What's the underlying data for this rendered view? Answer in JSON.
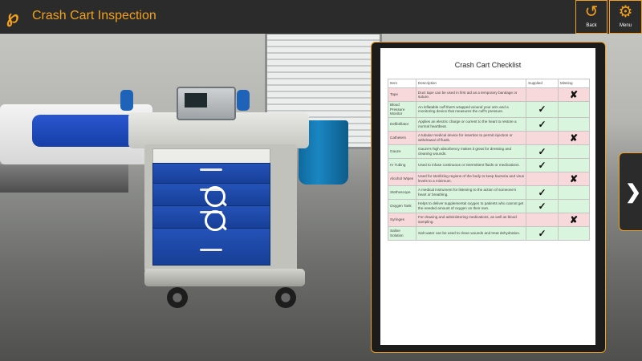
{
  "app": {
    "title": "Crash Cart Inspection",
    "logo_icon": "brand-logo-icon"
  },
  "header": {
    "back": {
      "label": "Back",
      "icon": "undo-arrow-icon"
    },
    "menu": {
      "label": "Menu",
      "icon": "gear-icon"
    }
  },
  "checklist": {
    "title": "Crash Cart Checklist",
    "columns": [
      "Item",
      "Description",
      "Supplied",
      "Missing"
    ],
    "rows": [
      {
        "item": "Tape",
        "description": "Duct tape can be used in first aid as a temporary bandage or suture.",
        "status": "missing"
      },
      {
        "item": "Blood Pressure Monitor",
        "description": "An inflatable cuff that's wrapped around your arm and a monitoring device that measures the cuff's pressure.",
        "status": "supplied"
      },
      {
        "item": "Defibrillator",
        "description": "Applies an electric charge or current to the heart to restore a normal heartbeat.",
        "status": "supplied"
      },
      {
        "item": "Catheters",
        "description": "A tubular medical device for insertion to permit injection or withdrawal of fluids.",
        "status": "missing"
      },
      {
        "item": "Gauze",
        "description": "Gauze's high absorbency makes it great for dressing and cleaning wounds.",
        "status": "supplied"
      },
      {
        "item": "IV Tubing",
        "description": "Used to infuse continuous or intermittent fluids or medications.",
        "status": "supplied"
      },
      {
        "item": "Alcohol Wipes",
        "description": "Used for sterilizing regions of the body to keep bacteria and virus levels to a minimum.",
        "status": "missing"
      },
      {
        "item": "Stethoscope",
        "description": "A medical instrument for listening to the action of someone's heart or breathing.",
        "status": "supplied"
      },
      {
        "item": "Oxygen Tank",
        "description": "Helps to deliver supplemental oxygen to patients who cannot get the needed amount of oxygen on their own.",
        "status": "supplied"
      },
      {
        "item": "Syringes",
        "description": "For drawing and administering medications, as well as blood sampling.",
        "status": "missing"
      },
      {
        "item": "Saline Solution",
        "description": "Salt water can be used to clean wounds and treat dehydration.",
        "status": "supplied"
      }
    ],
    "check_glyph": "✓",
    "cross_glyph": "✘"
  },
  "navigation": {
    "next_icon": "chevron-right-icon"
  },
  "colors": {
    "accent": "#f2a11c",
    "header_bg": "#2b2b2b",
    "row_supplied": "#d9f5dd",
    "row_missing": "#f8d9db"
  }
}
